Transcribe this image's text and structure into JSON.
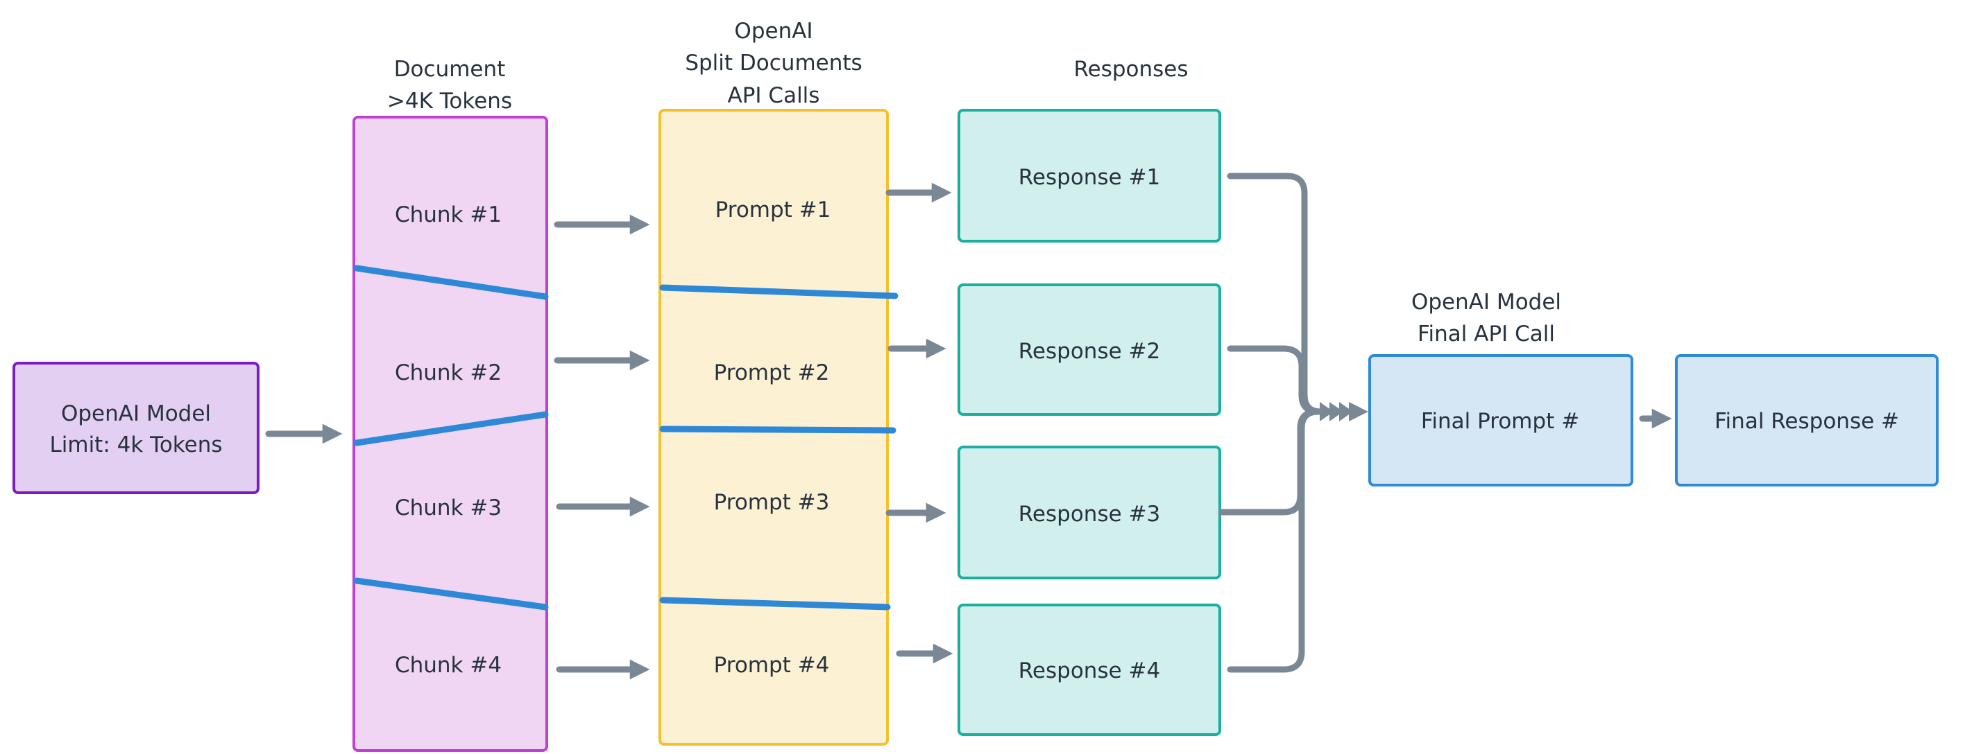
{
  "colors": {
    "model_fill": "#e3cff2",
    "model_stroke": "#7a1bc4",
    "chunk_fill": "#f1d6f3",
    "chunk_stroke": "#c23fd3",
    "prompt_fill": "#fcf1d2",
    "prompt_stroke": "#f5c02c",
    "response_fill": "#d1efed",
    "response_stroke": "#1ab0a0",
    "final_fill": "#d5e6f5",
    "final_stroke": "#2f8ad8",
    "split_line": "#2e88d8",
    "arrow": "#7a8896",
    "text": "#28323f"
  },
  "model_box": {
    "line1": "OpenAI Model",
    "line2": "Limit: 4k Tokens"
  },
  "document": {
    "header_line1": "Document",
    "header_line2": ">4K Tokens",
    "chunks": [
      "Chunk #1",
      "Chunk #2",
      "Chunk #3",
      "Chunk #4"
    ]
  },
  "prompts": {
    "header_line1": "OpenAI",
    "header_line2": "Split Documents",
    "header_line3": "API Calls",
    "items": [
      "Prompt #1",
      "Prompt #2",
      "Prompt #3",
      "Prompt #4"
    ]
  },
  "responses": {
    "header": "Responses",
    "items": [
      "Response #1",
      "Response #2",
      "Response #3",
      "Response #4"
    ]
  },
  "final": {
    "header_line1": "OpenAI Model",
    "header_line2": "Final API Call",
    "prompt": "Final Prompt #",
    "response": "Final Response #"
  }
}
